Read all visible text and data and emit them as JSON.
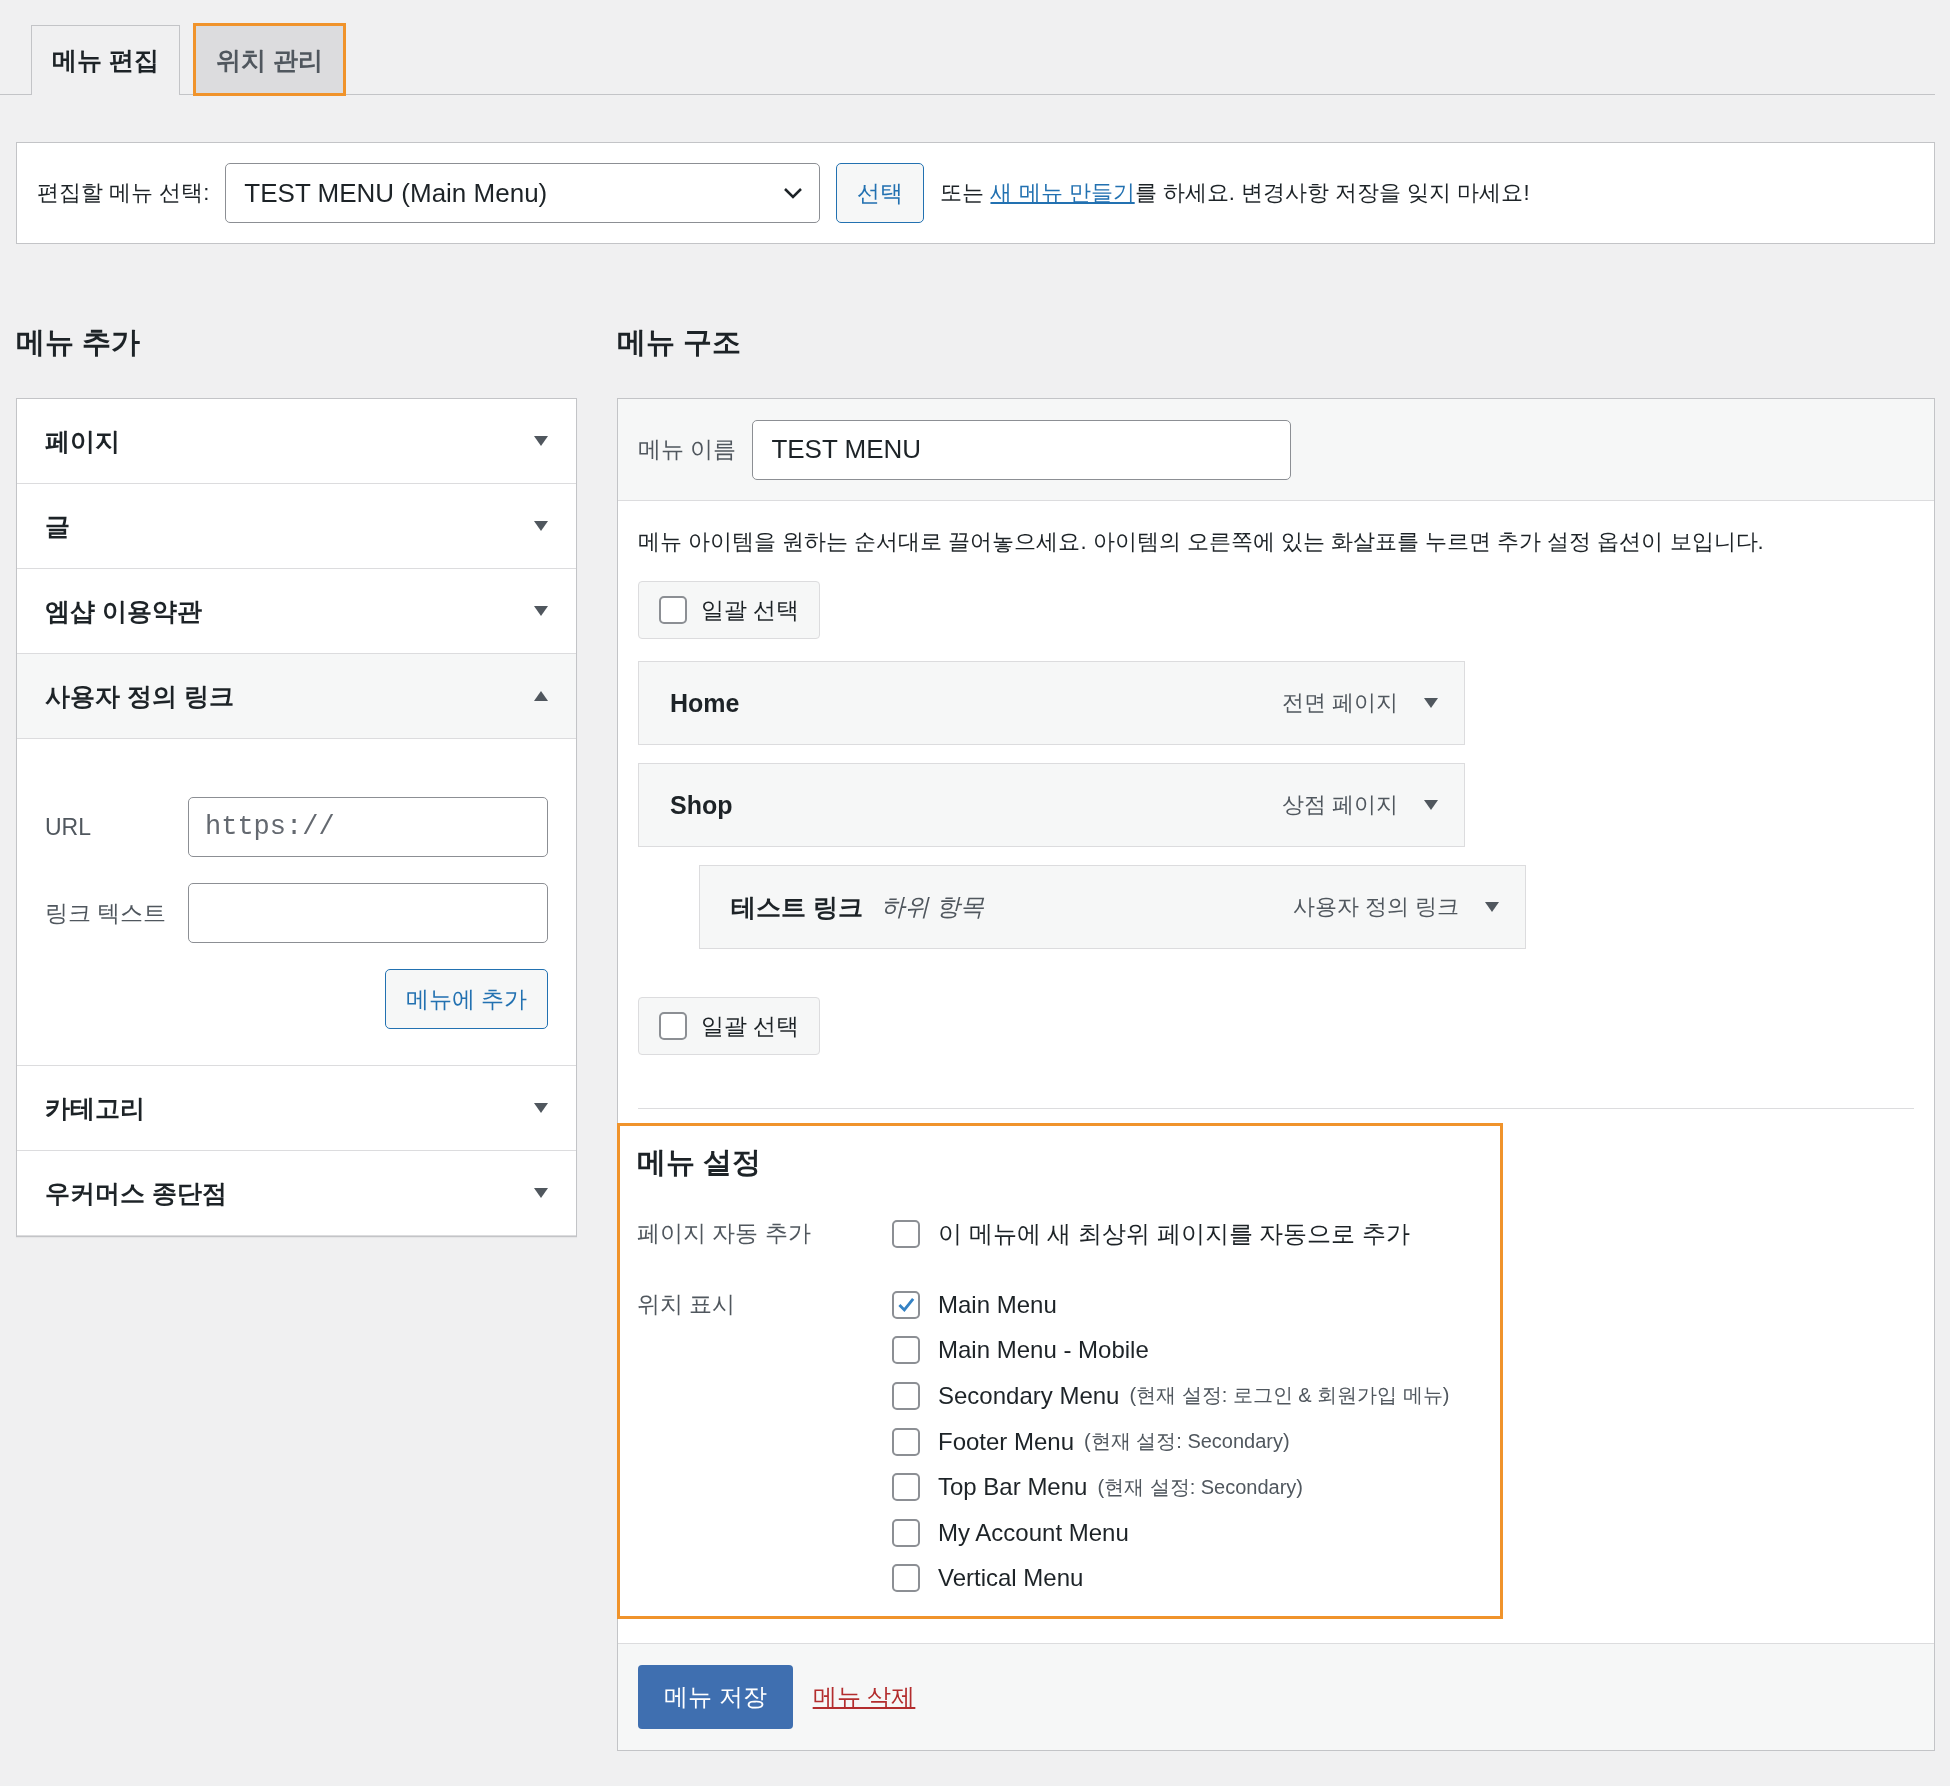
{
  "tabs": [
    {
      "label": "메뉴 편집",
      "selected": true,
      "highlighted": false
    },
    {
      "label": "위치 관리",
      "selected": false,
      "highlighted": true
    }
  ],
  "menu_select": {
    "label": "편집할 메뉴 선택:",
    "value": "TEST MENU (Main Menu)",
    "button": "선택",
    "text_before": "또는 ",
    "link": "새 메뉴 만들기",
    "text_after": "를 하세요. 변경사항 저장을 잊지 마세요!"
  },
  "add_menu": {
    "heading": "메뉴 추가",
    "sections": [
      {
        "title": "페이지",
        "expanded": false
      },
      {
        "title": "글",
        "expanded": false
      },
      {
        "title": "엠샵 이용약관",
        "expanded": false
      },
      {
        "title": "사용자 정의 링크",
        "expanded": true,
        "url_label": "URL",
        "url_placeholder": "https://",
        "link_text_label": "링크 텍스트",
        "button": "메뉴에 추가"
      },
      {
        "title": "카테고리",
        "expanded": false
      },
      {
        "title": "우커머스 종단점",
        "expanded": false
      }
    ]
  },
  "structure": {
    "heading": "메뉴 구조",
    "name_label": "메뉴 이름",
    "name_value": "TEST MENU",
    "instructions": "메뉴 아이템을 원하는 순서대로 끌어놓으세요. 아이템의 오른쪽에 있는 화살표를 누르면 추가 설정 옵션이 보입니다.",
    "bulk_top": {
      "label": "일괄 선택",
      "checked": false
    },
    "items": [
      {
        "title": "Home",
        "type": "전면 페이지"
      },
      {
        "title": "Shop",
        "type": "상점 페이지",
        "children": [
          {
            "title": "테스트 링크",
            "sub_label": "하위 항목",
            "type": "사용자 정의 링크"
          }
        ]
      }
    ],
    "bulk_bottom": {
      "label": "일괄 선택",
      "checked": false
    },
    "settings": {
      "heading": "메뉴 설정",
      "highlighted": true,
      "auto_add_label": "페이지 자동 추가",
      "auto_add": {
        "label": "이 메뉴에 새 최상위 페이지를 자동으로 추가",
        "checked": false
      },
      "locations_label": "위치 표시",
      "locations": [
        {
          "label": "Main Menu",
          "checked": true
        },
        {
          "label": "Main Menu - Mobile",
          "checked": false
        },
        {
          "label": "Secondary Menu",
          "note": "(현재 설정: 로그인 & 회원가입 메뉴)",
          "checked": false
        },
        {
          "label": "Footer Menu",
          "note": "(현재 설정: Secondary)",
          "checked": false
        },
        {
          "label": "Top Bar Menu",
          "note": "(현재 설정: Secondary)",
          "checked": false
        },
        {
          "label": "My Account Menu",
          "checked": false
        },
        {
          "label": "Vertical Menu",
          "checked": false
        }
      ]
    },
    "save_button": "메뉴 저장",
    "delete_link": "메뉴 삭제"
  }
}
